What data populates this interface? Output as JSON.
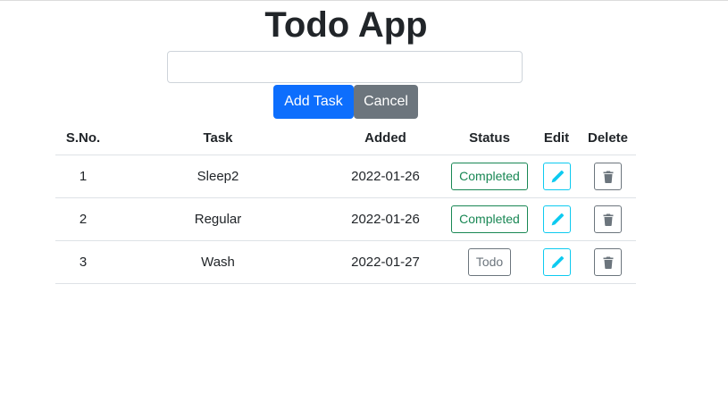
{
  "app": {
    "title": "Todo App"
  },
  "form": {
    "task_input_value": "",
    "task_input_placeholder": "",
    "add_label": "Add Task",
    "cancel_label": "Cancel"
  },
  "table": {
    "headers": {
      "sno": "S.No.",
      "task": "Task",
      "added": "Added",
      "status": "Status",
      "edit": "Edit",
      "delete": "Delete"
    },
    "rows": [
      {
        "sno": "1",
        "task": "Sleep2",
        "added": "2022-01-26",
        "status": "Completed"
      },
      {
        "sno": "2",
        "task": "Regular",
        "added": "2022-01-26",
        "status": "Completed"
      },
      {
        "sno": "3",
        "task": "Wash",
        "added": "2022-01-27",
        "status": "Todo"
      }
    ]
  },
  "icons": {
    "edit": "pencil-icon",
    "delete": "trash-icon"
  },
  "colors": {
    "primary": "#0d6efd",
    "secondary": "#6c757d",
    "success": "#198754",
    "info": "#0dcaf0"
  }
}
